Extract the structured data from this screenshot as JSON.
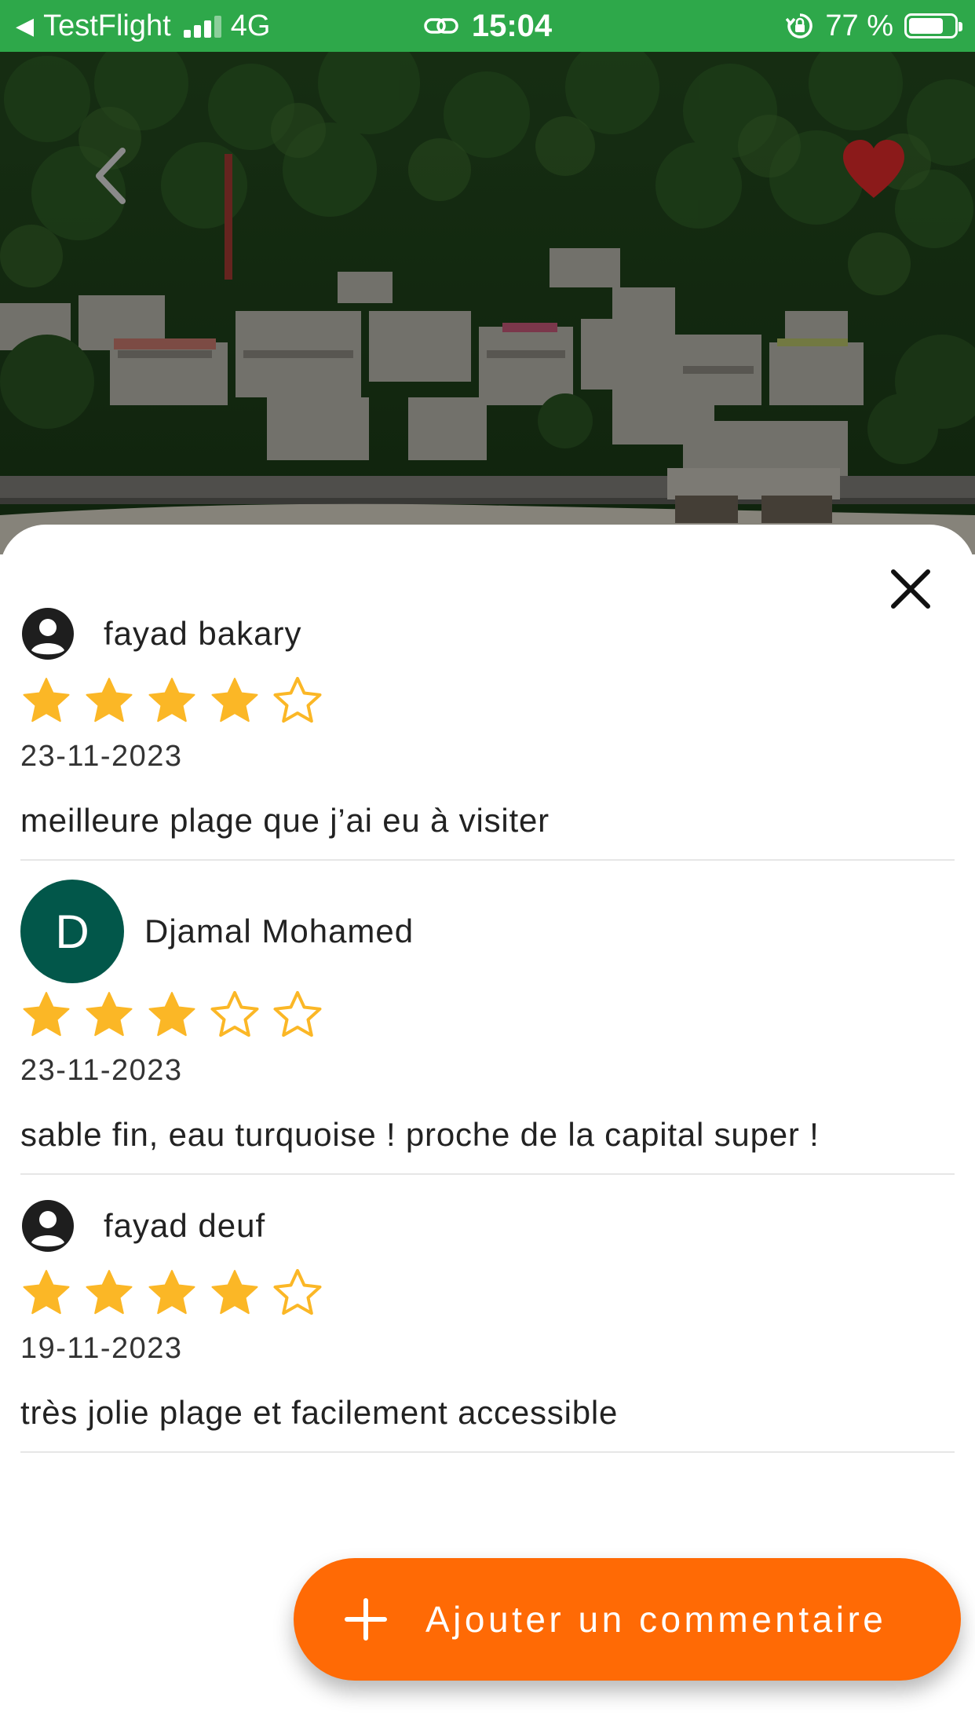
{
  "status_bar": {
    "back_app": "TestFlight",
    "network": "4G",
    "time": "15:04",
    "battery_text": "77 %",
    "battery_level": 0.77,
    "signal_bars": 3,
    "background_color": "#2ea84a"
  },
  "header": {
    "back_icon": "chevron-left-icon",
    "favorite_icon": "heart-icon",
    "favorite_color": "#8b1a1a"
  },
  "sheet": {
    "close_icon": "close-icon"
  },
  "reviews": [
    {
      "name": "fayad bakary",
      "avatar_type": "account-circle-icon",
      "avatar_letter": "",
      "rating": 4,
      "max_rating": 5,
      "date": "23-11-2023",
      "text": "meilleure plage que j’ai eu à visiter"
    },
    {
      "name": "Djamal Mohamed",
      "avatar_type": "letter",
      "avatar_letter": "D",
      "rating": 3,
      "max_rating": 5,
      "date": "23-11-2023",
      "text": "sable fin, eau turquoise ! proche de la capital super !"
    },
    {
      "name": "fayad deuf",
      "avatar_type": "account-circle-icon",
      "avatar_letter": "",
      "rating": 4,
      "max_rating": 5,
      "date": "19-11-2023",
      "text": "très jolie plage et facilement accessible"
    }
  ],
  "fab": {
    "label": "Ajouter un commentaire",
    "icon": "plus-icon",
    "color": "#ff6a05"
  },
  "colors": {
    "star_filled": "#fbb726",
    "avatar_letter_bg": "#02574a"
  }
}
